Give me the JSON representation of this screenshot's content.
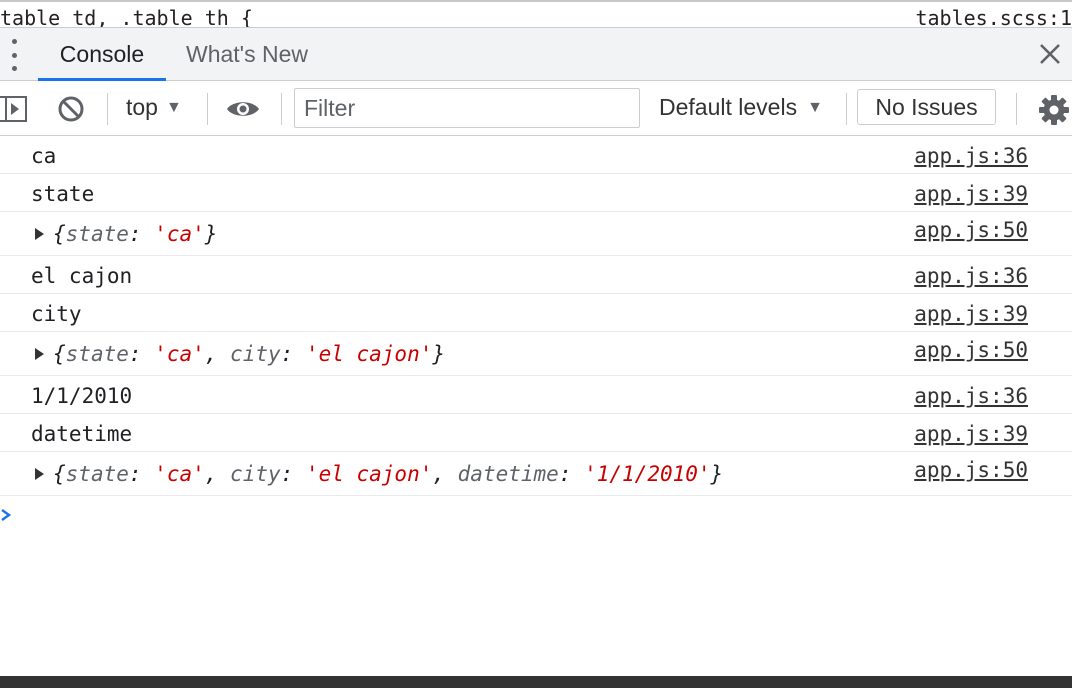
{
  "topstrip": {
    "selector": "table td, .table th {",
    "source": "tables.scss:1"
  },
  "tabs": {
    "active": "Console",
    "other": "What's New"
  },
  "toolbar": {
    "context": "top",
    "filter_placeholder": "Filter",
    "levels": "Default levels",
    "issues": "No Issues"
  },
  "messages": [
    {
      "text": "ca",
      "source": "app.js:36"
    },
    {
      "text": "state",
      "source": "app.js:39"
    },
    {
      "source": "app.js:50"
    },
    {
      "text": "el cajon",
      "source": "app.js:36"
    },
    {
      "text": "city",
      "source": "app.js:39"
    },
    {
      "source": "app.js:50"
    },
    {
      "text": "1/1/2010",
      "source": "app.js:36"
    },
    {
      "text": "datetime",
      "source": "app.js:39"
    },
    {
      "source": "app.js:50"
    }
  ],
  "objects": {
    "o1": {
      "state_key": "state",
      "state_val": "'ca'"
    },
    "o2": {
      "state_key": "state",
      "state_val": "'ca'",
      "city_key": "city",
      "city_val": "'el cajon'"
    },
    "o3": {
      "state_key": "state",
      "state_val": "'ca'",
      "city_key": "city",
      "city_val": "'el cajon'",
      "datetime_key": "datetime",
      "datetime_val": "'1/1/2010'"
    }
  },
  "colors": {
    "accent": "#1a73e8",
    "string": "#c80000",
    "key": "#5f6368"
  }
}
